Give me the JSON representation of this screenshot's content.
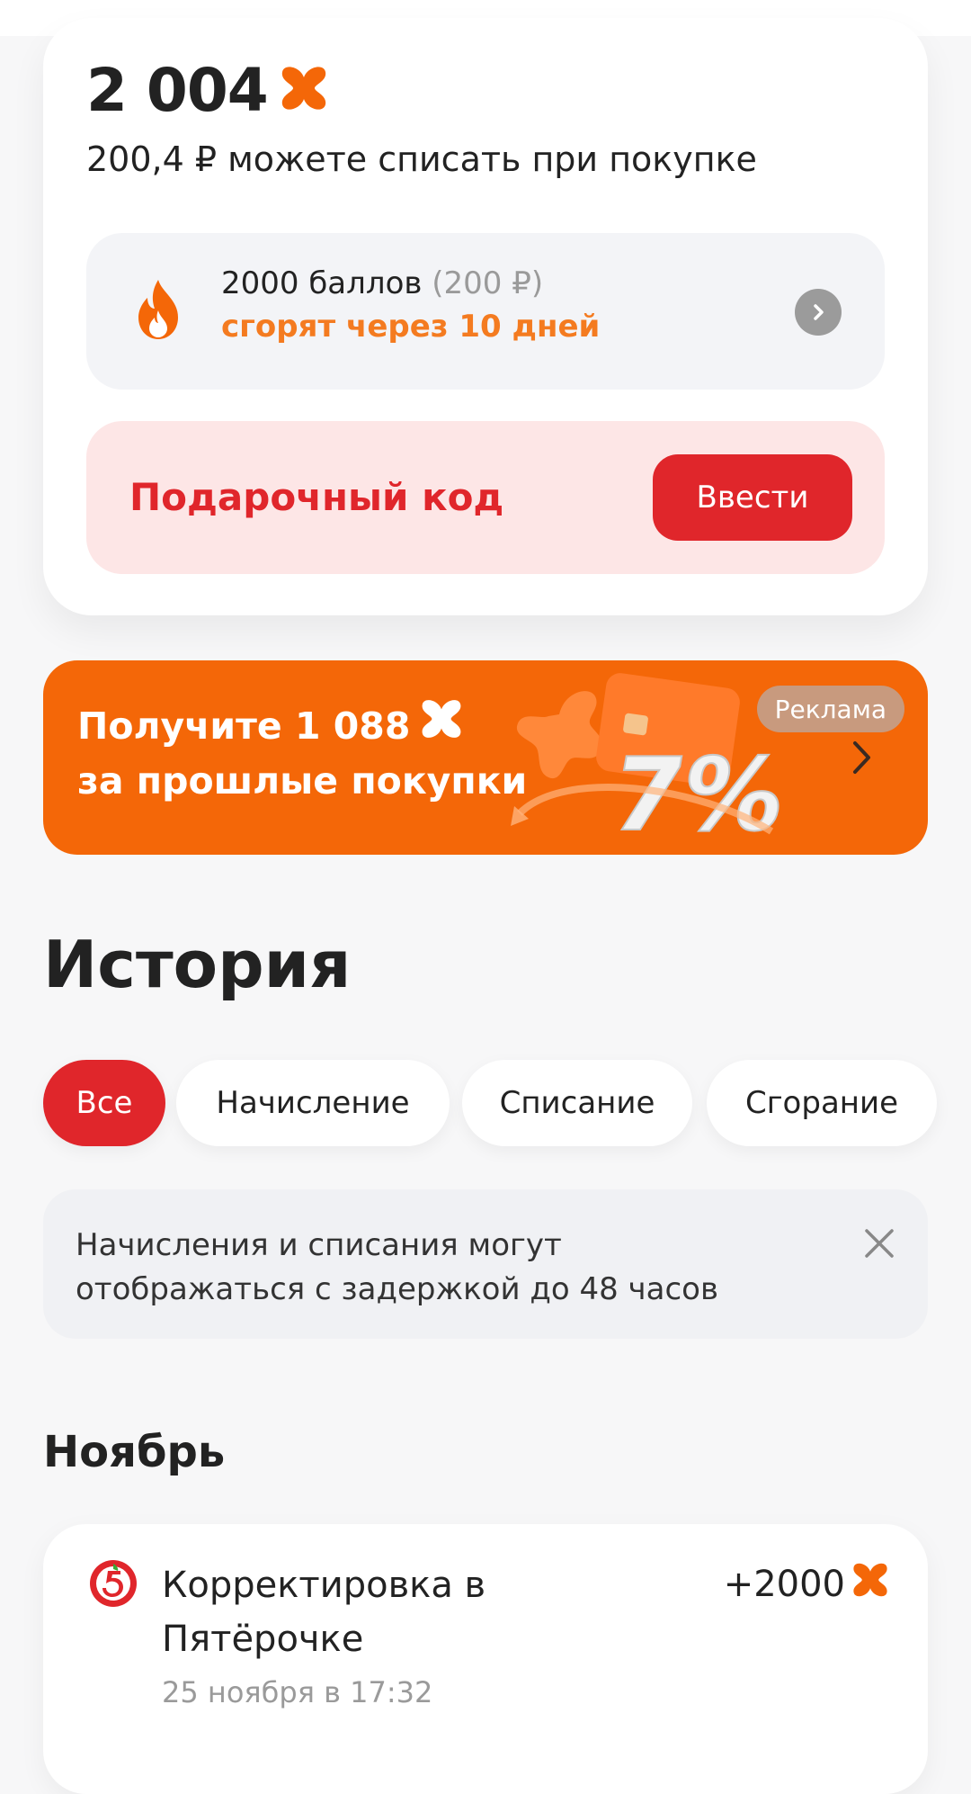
{
  "balance": {
    "points": "2 004",
    "rub_text": "200,4 ₽ можете списать при покупке",
    "burn": {
      "points_text": "2000 баллов",
      "rub_text": "(200 ₽)",
      "expire_text": "сгорят через 10 дней"
    },
    "gift": {
      "label": "Подарочный код",
      "button": "Ввести"
    }
  },
  "promo": {
    "line1": "Получите 1 088",
    "line2": "за прошлые покупки",
    "ad_badge": "Реклама",
    "art_text": "7%"
  },
  "history": {
    "title": "История",
    "filters": [
      "Все",
      "Начисление",
      "Списание",
      "Сгорание"
    ],
    "active_filter": "Все",
    "notice": {
      "line1": "Начисления и списания могут",
      "line2": "отображаться с задержкой до 48 часов"
    },
    "month": "Ноябрь",
    "transactions": [
      {
        "title": "Корректировка в Пятёрочке",
        "date": "25 ноября в 17:32",
        "amount": "+2000"
      }
    ]
  },
  "colors": {
    "accent_red": "#e0262b",
    "accent_orange": "#f46708",
    "points_orange": "#f47b20"
  },
  "icons": {
    "points": "x-points-icon",
    "fire": "fire-icon",
    "chevron": "chevron-right-icon",
    "close": "close-icon",
    "store": "pyaterochka-logo"
  }
}
